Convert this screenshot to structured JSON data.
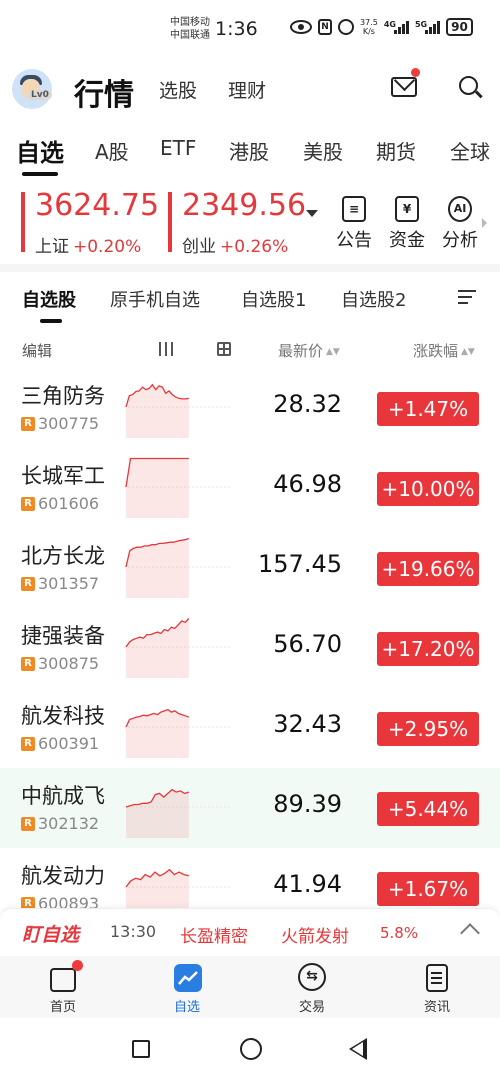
{
  "status_bar": {
    "carrier_1": "中国移动",
    "carrier_2": "中国联通",
    "time": "1:36",
    "net_speed_value": "37.5",
    "net_speed_unit": "K/s",
    "signal_1": "4G",
    "signal_2": "5G",
    "battery": "90"
  },
  "header": {
    "title": "行情",
    "nav": [
      "选股",
      "理财"
    ],
    "avatar_level": "Lv0"
  },
  "market_tabs": [
    "自选",
    "A股",
    "ETF",
    "港股",
    "美股",
    "期货",
    "全球"
  ],
  "indices": [
    {
      "value": "3624.75",
      "name": "上证",
      "change": "+0.20%"
    },
    {
      "value": "2349.56",
      "name": "创业",
      "change": "+0.26%"
    }
  ],
  "quick_actions": [
    {
      "label": "公告",
      "icon": "announcement-icon"
    },
    {
      "label": "资金",
      "icon": "fund-icon",
      "glyph": "¥"
    },
    {
      "label": "分析",
      "icon": "ai-analysis-icon",
      "glyph": "AI"
    }
  ],
  "sub_tabs": [
    "自选股",
    "原手机自选",
    "自选股1",
    "自选股2"
  ],
  "columns": {
    "edit": "编辑",
    "price": "最新价",
    "change": "涨跌幅"
  },
  "stocks": [
    {
      "name": "三角防务",
      "code": "300775",
      "price": "28.32",
      "change": "+1.47%",
      "spark": [
        0.5,
        0.32,
        0.3,
        0.25,
        0.24,
        0.18,
        0.22,
        0.2,
        0.14,
        0.22,
        0.16,
        0.18,
        0.28,
        0.24,
        0.3,
        0.34,
        0.36,
        0.37,
        0.37,
        0.36
      ]
    },
    {
      "name": "长城军工",
      "code": "601606",
      "price": "46.98",
      "change": "+10.00%",
      "spark": [
        0.5,
        0.04,
        0.04,
        0.04,
        0.04,
        0.04,
        0.04,
        0.04,
        0.04,
        0.04,
        0.04,
        0.04,
        0.04,
        0.04,
        0.04
      ]
    },
    {
      "name": "北方长龙",
      "code": "301357",
      "price": "157.45",
      "change": "+19.66%",
      "spark": [
        0.5,
        0.24,
        0.2,
        0.18,
        0.18,
        0.16,
        0.16,
        0.14,
        0.14,
        0.12,
        0.12,
        0.11,
        0.1,
        0.1,
        0.08,
        0.07,
        0.06,
        0.04
      ]
    },
    {
      "name": "捷强装备",
      "code": "300875",
      "price": "56.70",
      "change": "+17.20%",
      "spark": [
        0.5,
        0.42,
        0.38,
        0.36,
        0.34,
        0.36,
        0.3,
        0.3,
        0.28,
        0.26,
        0.28,
        0.22,
        0.24,
        0.18,
        0.2,
        0.14,
        0.08,
        0.1,
        0.04
      ]
    },
    {
      "name": "航发科技",
      "code": "600391",
      "price": "32.43",
      "change": "+2.95%",
      "spark": [
        0.5,
        0.38,
        0.36,
        0.34,
        0.33,
        0.31,
        0.32,
        0.3,
        0.28,
        0.3,
        0.26,
        0.24,
        0.22,
        0.26,
        0.24,
        0.28,
        0.3,
        0.32,
        0.34
      ]
    },
    {
      "name": "中航成飞",
      "code": "302132",
      "price": "89.39",
      "change": "+5.44%",
      "spark": [
        0.5,
        0.48,
        0.46,
        0.46,
        0.44,
        0.44,
        0.42,
        0.3,
        0.28,
        0.34,
        0.28,
        0.22,
        0.26,
        0.24,
        0.28,
        0.26
      ],
      "highlight": true
    },
    {
      "name": "航发动力",
      "code": "600893",
      "price": "41.94",
      "change": "+1.67%",
      "spark": [
        0.5,
        0.4,
        0.36,
        0.38,
        0.3,
        0.34,
        0.26,
        0.32,
        0.28,
        0.22,
        0.3,
        0.26,
        0.3,
        0.32
      ]
    }
  ],
  "ticker": {
    "brand": "盯自选",
    "time": "13:30",
    "item_1": "长盈精密",
    "item_2": "火箭发射",
    "item_3": "5.8%"
  },
  "bottom_nav": [
    {
      "label": "首页",
      "icon": "home-icon"
    },
    {
      "label": "自选",
      "icon": "watchlist-icon"
    },
    {
      "label": "交易",
      "icon": "trade-icon"
    },
    {
      "label": "资讯",
      "icon": "news-icon"
    }
  ],
  "colors": {
    "up_red": "#e8363b",
    "accent_blue": "#1f6fd6",
    "highlight_bg": "#f2faf5"
  }
}
